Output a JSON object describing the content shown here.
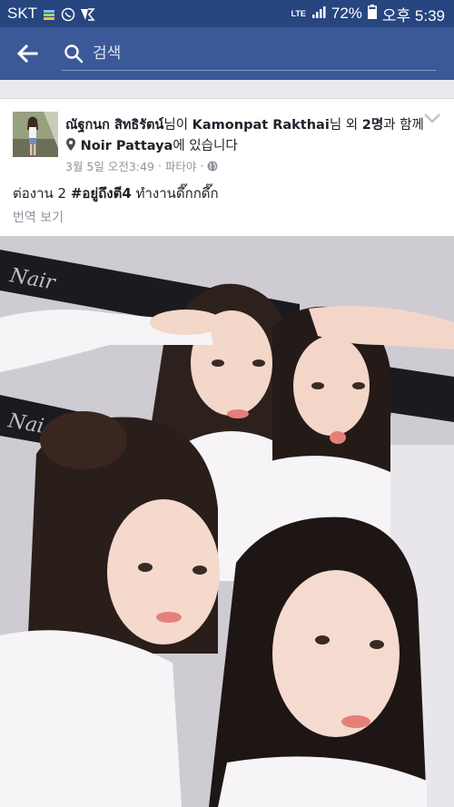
{
  "status_bar": {
    "carrier": "SKT",
    "network": "LTE",
    "battery": "72%",
    "time": "오후 5:39"
  },
  "search": {
    "placeholder": "검색"
  },
  "post": {
    "author": "ณัฐกนก สิทธิรัตน์",
    "suffix_1": "님이 ",
    "tagged_user": "Kamonpat Rakthai",
    "suffix_2": "님 외 ",
    "others": "2명",
    "suffix_3": "과 함께 ",
    "place": "Noir Pattaya",
    "suffix_4": "에 있습니다",
    "date": "3월 5일 오전3:49",
    "separator": "·",
    "location": "파타야",
    "text_prefix": "ต่องาน 2 ",
    "hashtag": "#อยู่ถึงตี4",
    "text_suffix": " ทำงานดึ๊กกดึ๊ก",
    "translate_label": "번역 보기"
  },
  "colors": {
    "status_bar": "#27457f",
    "header": "#3b5998",
    "meta_text": "#90949c"
  }
}
